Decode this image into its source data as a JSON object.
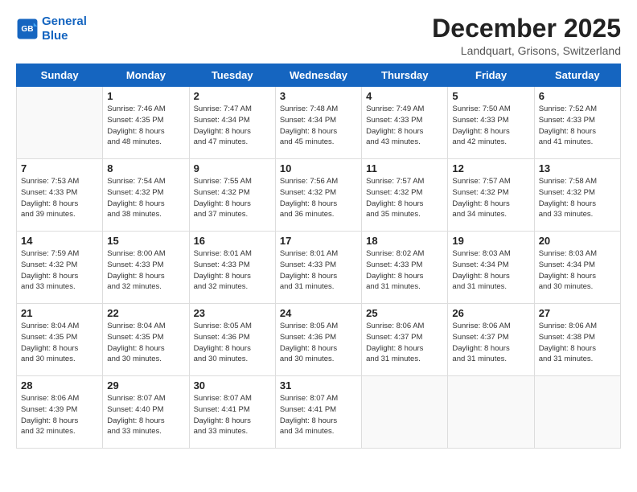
{
  "header": {
    "logo_line1": "General",
    "logo_line2": "Blue",
    "month_title": "December 2025",
    "location": "Landquart, Grisons, Switzerland"
  },
  "days_of_week": [
    "Sunday",
    "Monday",
    "Tuesday",
    "Wednesday",
    "Thursday",
    "Friday",
    "Saturday"
  ],
  "weeks": [
    [
      {
        "day": "",
        "info": ""
      },
      {
        "day": "1",
        "info": "Sunrise: 7:46 AM\nSunset: 4:35 PM\nDaylight: 8 hours\nand 48 minutes."
      },
      {
        "day": "2",
        "info": "Sunrise: 7:47 AM\nSunset: 4:34 PM\nDaylight: 8 hours\nand 47 minutes."
      },
      {
        "day": "3",
        "info": "Sunrise: 7:48 AM\nSunset: 4:34 PM\nDaylight: 8 hours\nand 45 minutes."
      },
      {
        "day": "4",
        "info": "Sunrise: 7:49 AM\nSunset: 4:33 PM\nDaylight: 8 hours\nand 43 minutes."
      },
      {
        "day": "5",
        "info": "Sunrise: 7:50 AM\nSunset: 4:33 PM\nDaylight: 8 hours\nand 42 minutes."
      },
      {
        "day": "6",
        "info": "Sunrise: 7:52 AM\nSunset: 4:33 PM\nDaylight: 8 hours\nand 41 minutes."
      }
    ],
    [
      {
        "day": "7",
        "info": "Sunrise: 7:53 AM\nSunset: 4:33 PM\nDaylight: 8 hours\nand 39 minutes."
      },
      {
        "day": "8",
        "info": "Sunrise: 7:54 AM\nSunset: 4:32 PM\nDaylight: 8 hours\nand 38 minutes."
      },
      {
        "day": "9",
        "info": "Sunrise: 7:55 AM\nSunset: 4:32 PM\nDaylight: 8 hours\nand 37 minutes."
      },
      {
        "day": "10",
        "info": "Sunrise: 7:56 AM\nSunset: 4:32 PM\nDaylight: 8 hours\nand 36 minutes."
      },
      {
        "day": "11",
        "info": "Sunrise: 7:57 AM\nSunset: 4:32 PM\nDaylight: 8 hours\nand 35 minutes."
      },
      {
        "day": "12",
        "info": "Sunrise: 7:57 AM\nSunset: 4:32 PM\nDaylight: 8 hours\nand 34 minutes."
      },
      {
        "day": "13",
        "info": "Sunrise: 7:58 AM\nSunset: 4:32 PM\nDaylight: 8 hours\nand 33 minutes."
      }
    ],
    [
      {
        "day": "14",
        "info": "Sunrise: 7:59 AM\nSunset: 4:32 PM\nDaylight: 8 hours\nand 33 minutes."
      },
      {
        "day": "15",
        "info": "Sunrise: 8:00 AM\nSunset: 4:33 PM\nDaylight: 8 hours\nand 32 minutes."
      },
      {
        "day": "16",
        "info": "Sunrise: 8:01 AM\nSunset: 4:33 PM\nDaylight: 8 hours\nand 32 minutes."
      },
      {
        "day": "17",
        "info": "Sunrise: 8:01 AM\nSunset: 4:33 PM\nDaylight: 8 hours\nand 31 minutes."
      },
      {
        "day": "18",
        "info": "Sunrise: 8:02 AM\nSunset: 4:33 PM\nDaylight: 8 hours\nand 31 minutes."
      },
      {
        "day": "19",
        "info": "Sunrise: 8:03 AM\nSunset: 4:34 PM\nDaylight: 8 hours\nand 31 minutes."
      },
      {
        "day": "20",
        "info": "Sunrise: 8:03 AM\nSunset: 4:34 PM\nDaylight: 8 hours\nand 30 minutes."
      }
    ],
    [
      {
        "day": "21",
        "info": "Sunrise: 8:04 AM\nSunset: 4:35 PM\nDaylight: 8 hours\nand 30 minutes."
      },
      {
        "day": "22",
        "info": "Sunrise: 8:04 AM\nSunset: 4:35 PM\nDaylight: 8 hours\nand 30 minutes."
      },
      {
        "day": "23",
        "info": "Sunrise: 8:05 AM\nSunset: 4:36 PM\nDaylight: 8 hours\nand 30 minutes."
      },
      {
        "day": "24",
        "info": "Sunrise: 8:05 AM\nSunset: 4:36 PM\nDaylight: 8 hours\nand 30 minutes."
      },
      {
        "day": "25",
        "info": "Sunrise: 8:06 AM\nSunset: 4:37 PM\nDaylight: 8 hours\nand 31 minutes."
      },
      {
        "day": "26",
        "info": "Sunrise: 8:06 AM\nSunset: 4:37 PM\nDaylight: 8 hours\nand 31 minutes."
      },
      {
        "day": "27",
        "info": "Sunrise: 8:06 AM\nSunset: 4:38 PM\nDaylight: 8 hours\nand 31 minutes."
      }
    ],
    [
      {
        "day": "28",
        "info": "Sunrise: 8:06 AM\nSunset: 4:39 PM\nDaylight: 8 hours\nand 32 minutes."
      },
      {
        "day": "29",
        "info": "Sunrise: 8:07 AM\nSunset: 4:40 PM\nDaylight: 8 hours\nand 33 minutes."
      },
      {
        "day": "30",
        "info": "Sunrise: 8:07 AM\nSunset: 4:41 PM\nDaylight: 8 hours\nand 33 minutes."
      },
      {
        "day": "31",
        "info": "Sunrise: 8:07 AM\nSunset: 4:41 PM\nDaylight: 8 hours\nand 34 minutes."
      },
      {
        "day": "",
        "info": ""
      },
      {
        "day": "",
        "info": ""
      },
      {
        "day": "",
        "info": ""
      }
    ]
  ]
}
